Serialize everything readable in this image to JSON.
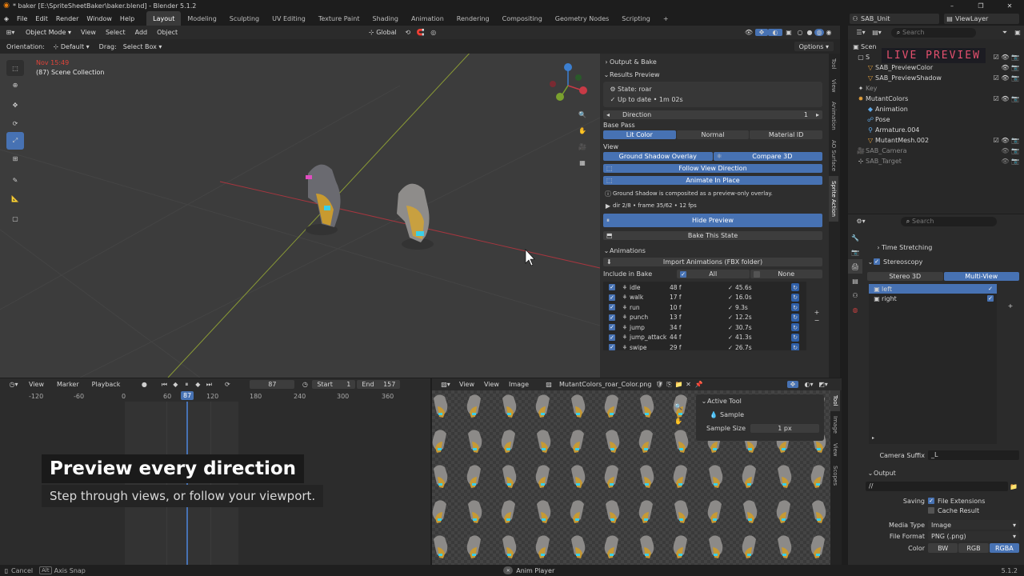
{
  "window": {
    "title": "* baker [E:\\SpriteSheetBaker\\baker.blend] - Blender 5.1.2",
    "controls": [
      "–",
      "❐",
      "✕"
    ]
  },
  "menu": {
    "items": [
      "File",
      "Edit",
      "Render",
      "Window",
      "Help"
    ],
    "workspaces": [
      "Layout",
      "Modeling",
      "Sculpting",
      "UV Editing",
      "Texture Paint",
      "Shading",
      "Animation",
      "Rendering",
      "Compositing",
      "Geometry Nodes",
      "Scripting"
    ],
    "add_workspace": "+",
    "scene": "SAB_Unit",
    "view_layer": "ViewLayer"
  },
  "viewport": {
    "mode": "Object Mode",
    "menus": [
      "View",
      "Select",
      "Add",
      "Object"
    ],
    "transform": "Global",
    "orientation_label": "Orientation:",
    "orientation_value": "Default",
    "drag_label": "Drag:",
    "drag_value": "Select Box",
    "options": "Options",
    "overlay_text_red": "Nov 15:49",
    "overlay_text": "(87) Scene Collection"
  },
  "npanel": {
    "output_bake": "Output & Bake",
    "results_preview": "Results Preview",
    "state": "State: roar",
    "up_to_date": "Up to date • 1m 02s",
    "direction_label": "Direction",
    "direction_value": "1",
    "base_pass": "Base Pass",
    "passes": [
      "Lit Color",
      "Normal",
      "Material ID"
    ],
    "view": "View",
    "ground_shadow_overlay": "Ground Shadow Overlay",
    "compare_3d": "Compare 3D",
    "follow_view_direction": "Follow View Direction",
    "animate_in_place": "Animate In Place",
    "info": "Ground Shadow is composited as a preview-only overlay.",
    "playback": "dir 2/8  •  frame 35/62  •  12 fps",
    "hide_preview": "Hide Preview",
    "bake_state": "Bake This State",
    "animations": "Animations",
    "import_animations": "Import Animations (FBX folder)",
    "include_in_bake": "Include in Bake",
    "all": "All",
    "none": "None",
    "anim_list": [
      {
        "name": "idle",
        "frames": "48 f",
        "time": "45.6s"
      },
      {
        "name": "walk",
        "frames": "17 f",
        "time": "16.0s"
      },
      {
        "name": "run",
        "frames": "10 f",
        "time": "9.3s"
      },
      {
        "name": "punch",
        "frames": "13 f",
        "time": "12.2s"
      },
      {
        "name": "jump",
        "frames": "34 f",
        "time": "30.7s"
      },
      {
        "name": "jump_attack",
        "frames": "44 f",
        "time": "41.3s"
      },
      {
        "name": "swipe",
        "frames": "29 f",
        "time": "26.7s"
      }
    ],
    "tabs": [
      "Tool",
      "View",
      "Animation",
      "AO Surface",
      "Sprite Action"
    ]
  },
  "outliner": {
    "search": "Search",
    "live_preview": "LIVE PREVIEW",
    "items": [
      {
        "label": "Scen",
        "indent": 0
      },
      {
        "label": "S",
        "indent": 1
      },
      {
        "label": "SAB_PreviewColor",
        "indent": 2
      },
      {
        "label": "SAB_PreviewShadow",
        "indent": 2
      },
      {
        "label": "Key",
        "indent": 1
      },
      {
        "label": "MutantColors",
        "indent": 1
      },
      {
        "label": "Animation",
        "indent": 2
      },
      {
        "label": "Pose",
        "indent": 2
      },
      {
        "label": "Armature.004",
        "indent": 2
      },
      {
        "label": "MutantMesh.002",
        "indent": 2
      },
      {
        "label": "SAB_Camera",
        "indent": 1
      },
      {
        "label": "SAB_Target",
        "indent": 1
      }
    ]
  },
  "properties": {
    "search": "Search",
    "time_stretching": "Time Stretching",
    "stereoscopy": "Stereoscopy",
    "stereo_3d": "Stereo 3D",
    "multi_view": "Multi-View",
    "views": [
      "left",
      "right"
    ],
    "camera_suffix_label": "Camera Suffix",
    "camera_suffix_value": "_L",
    "output": "Output",
    "output_path": "//",
    "saving": "Saving",
    "file_extensions": "File Extensions",
    "cache_result": "Cache Result",
    "media_type_label": "Media Type",
    "media_type_value": "Image",
    "file_format_label": "File Format",
    "file_format_value": "PNG (.png)",
    "color_label": "Color",
    "color_options": [
      "BW",
      "RGB",
      "RGBA"
    ],
    "version": "5.1.2"
  },
  "timeline": {
    "menus": [
      "View",
      "Marker",
      "Playback"
    ],
    "current_frame": "87",
    "start_label": "Start",
    "start_value": "1",
    "end_label": "End",
    "end_value": "157",
    "ruler": [
      "-120",
      "-60",
      "0",
      "60",
      "87",
      "120",
      "180",
      "240",
      "300",
      "360"
    ]
  },
  "image_editor": {
    "menus": [
      "View",
      "View",
      "Image"
    ],
    "image_name": "MutantColors_roar_Color.png",
    "active_tool": "Active Tool",
    "sample": "Sample",
    "sample_size_label": "Sample Size",
    "sample_size_value": "1 px",
    "tabs": [
      "Tool",
      "Image",
      "View",
      "Scopes"
    ]
  },
  "caption": {
    "title": "Preview every direction",
    "subtitle": "Step through views, or follow your viewport."
  },
  "status": {
    "left": "Cancel",
    "key": "Alt",
    "snap": "Axis Snap",
    "center": "Anim Player",
    "right": "5.1.2"
  }
}
